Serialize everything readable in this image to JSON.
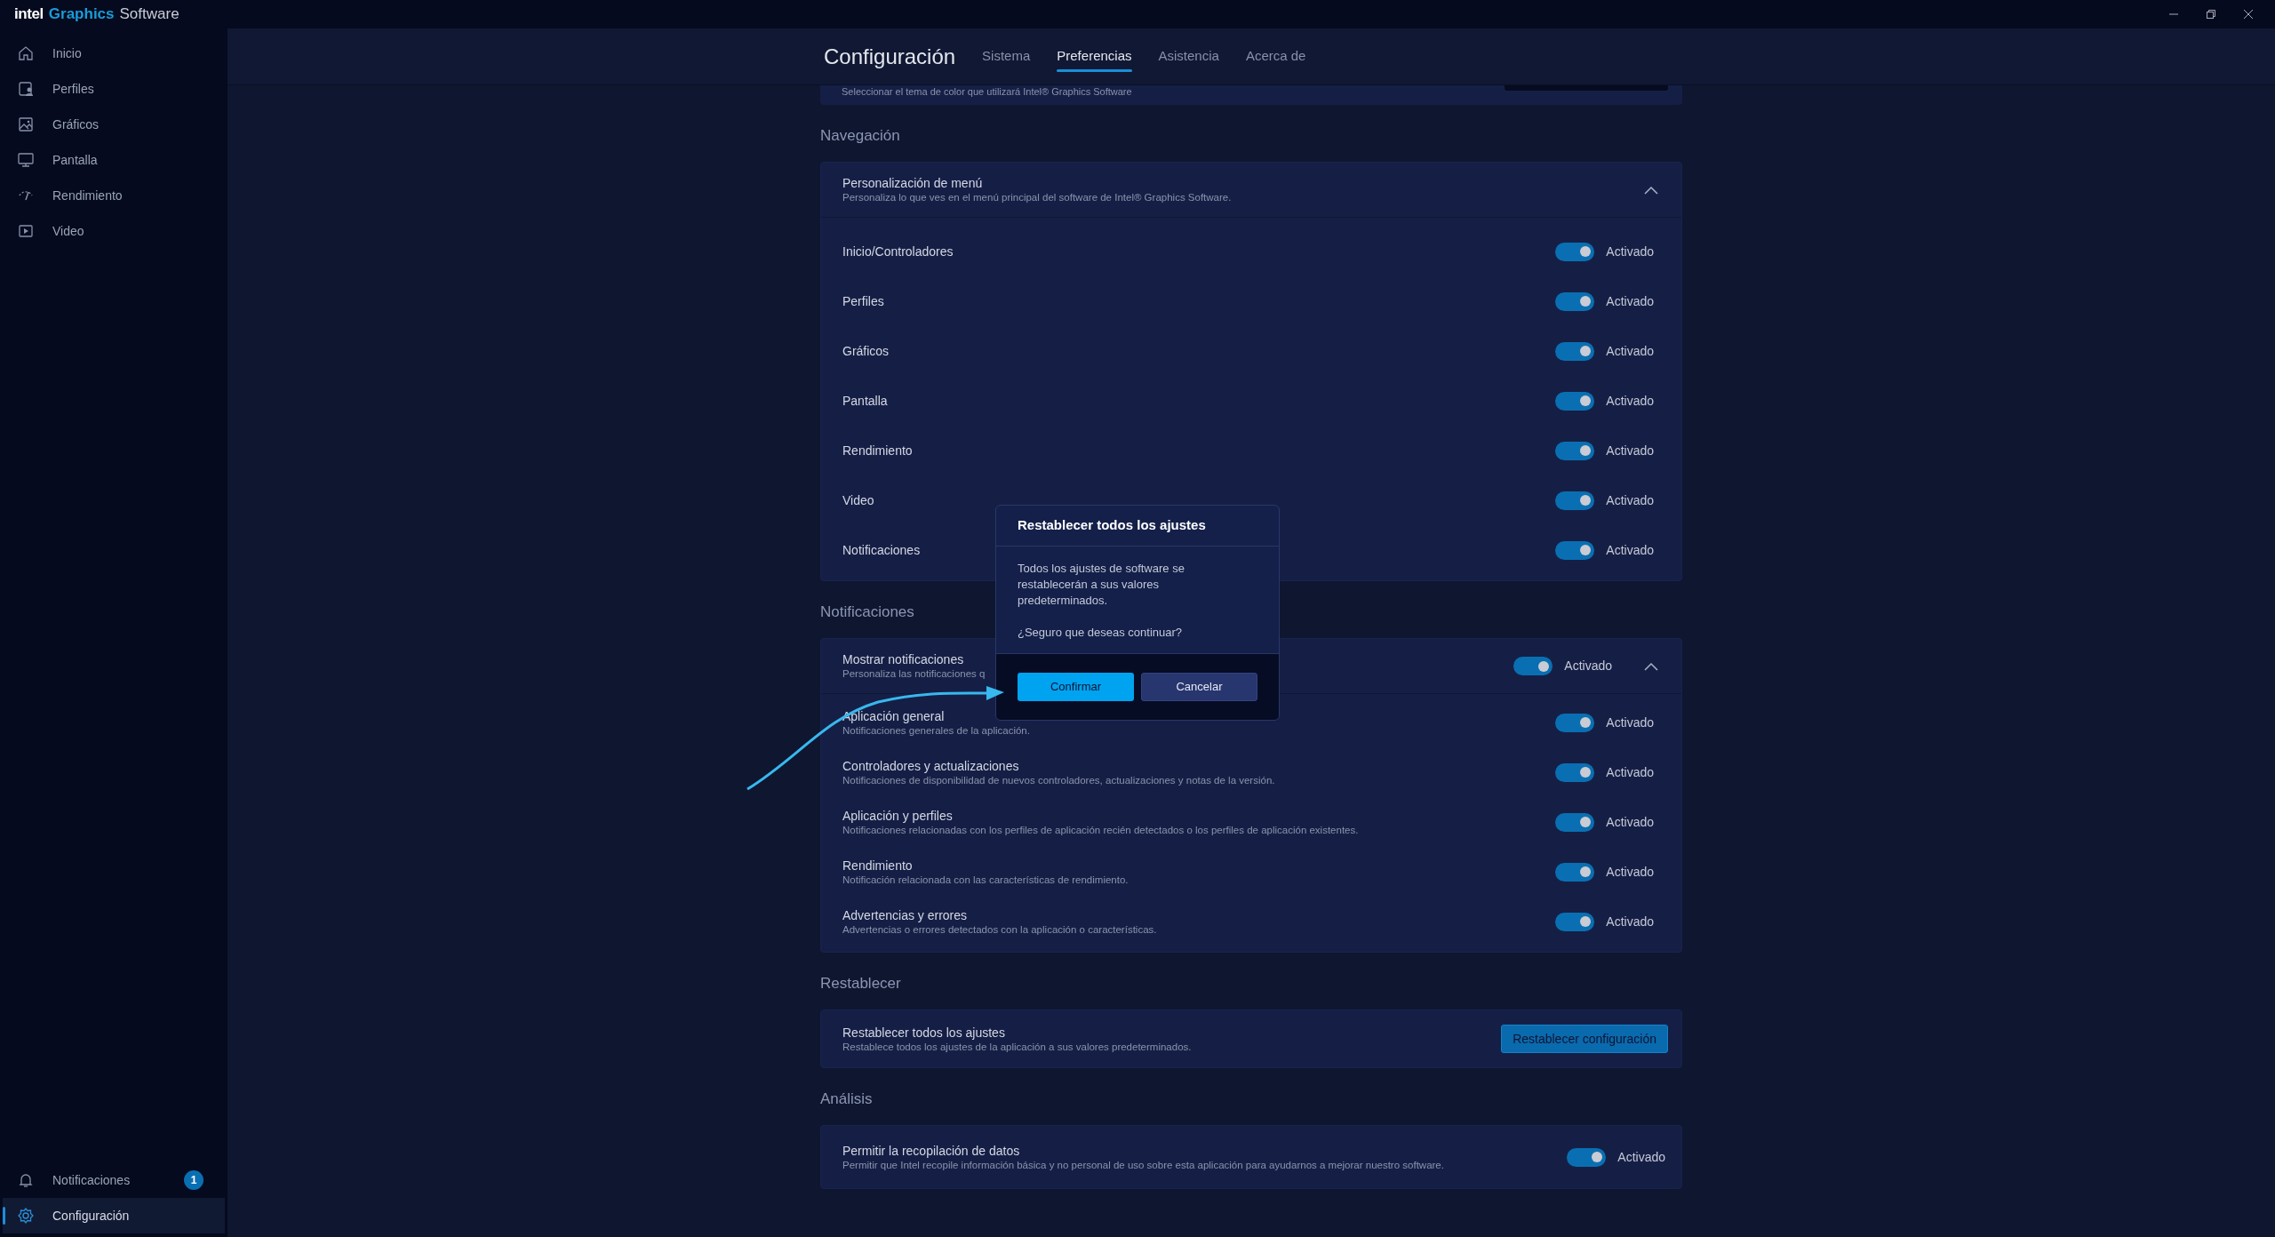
{
  "brand": {
    "intel": "intel",
    "graphics": "Graphics",
    "software": "Software"
  },
  "sidebar": {
    "items": [
      {
        "label": "Inicio",
        "kind": "home",
        "selected": false
      },
      {
        "label": "Perfiles",
        "kind": "profile",
        "selected": false
      },
      {
        "label": "Gráficos",
        "kind": "image",
        "selected": false
      },
      {
        "label": "Pantalla",
        "kind": "monitor",
        "selected": false
      },
      {
        "label": "Rendimiento",
        "kind": "gauge",
        "selected": false
      },
      {
        "label": "Video",
        "kind": "play",
        "selected": false
      }
    ],
    "bottom_items": [
      {
        "label": "Notificaciones",
        "kind": "bell",
        "badge": "1",
        "selected": false
      },
      {
        "label": "Configuración",
        "kind": "gear",
        "selected": true
      }
    ]
  },
  "header": {
    "title": "Configuración",
    "tabs": [
      {
        "label": "Sistema",
        "selected": false
      },
      {
        "label": "Preferencias",
        "selected": true
      },
      {
        "label": "Asistencia",
        "selected": false
      },
      {
        "label": "Acerca de",
        "selected": false
      }
    ]
  },
  "theme_card": {
    "description": "Seleccionar el tema de color que utilizará Intel® Graphics Software"
  },
  "sections": [
    {
      "heading": "Navegación",
      "kind": "group",
      "group": {
        "title": "Personalización de menú",
        "description": "Personaliza lo que ves en el menú principal del software de Intel® Graphics Software.",
        "expanded": true,
        "items": [
          {
            "label": "Inicio/Controladores",
            "on": true,
            "state": "Activado"
          },
          {
            "label": "Perfiles",
            "on": true,
            "state": "Activado"
          },
          {
            "label": "Gráficos",
            "on": true,
            "state": "Activado"
          },
          {
            "label": "Pantalla",
            "on": true,
            "state": "Activado"
          },
          {
            "label": "Rendimiento",
            "on": true,
            "state": "Activado"
          },
          {
            "label": "Video",
            "on": true,
            "state": "Activado"
          },
          {
            "label": "Notificaciones",
            "on": true,
            "state": "Activado"
          }
        ]
      }
    },
    {
      "heading": "Notificaciones",
      "kind": "group",
      "group": {
        "title": "Mostrar notificaciones",
        "description": "Personaliza las notificaciones q",
        "toggle": {
          "on": true,
          "state": "Activado"
        },
        "expanded": true,
        "items": [
          {
            "label": "Aplicación general",
            "description": "Notificaciones generales de la aplicación.",
            "on": true,
            "state": "Activado"
          },
          {
            "label": "Controladores y actualizaciones",
            "description": "Notificaciones de disponibilidad de nuevos controladores, actualizaciones y notas de la versión.",
            "on": true,
            "state": "Activado"
          },
          {
            "label": "Aplicación y perfiles",
            "description": "Notificaciones relacionadas con los perfiles de aplicación recién detectados o los perfiles de aplicación existentes.",
            "on": true,
            "state": "Activado"
          },
          {
            "label": "Rendimiento",
            "description": "Notificación relacionada con las características de rendimiento.",
            "on": true,
            "state": "Activado"
          },
          {
            "label": "Advertencias y errores",
            "description": "Advertencias o errores detectados con la aplicación o características.",
            "on": true,
            "state": "Activado"
          }
        ]
      }
    },
    {
      "heading": "Restablecer",
      "kind": "action",
      "title": "Restablecer todos los ajustes",
      "description": "Restablece todos los ajustes de la aplicación a sus valores predeterminados.",
      "button": "Restablecer configuración"
    },
    {
      "heading": "Análisis",
      "kind": "toggle",
      "title": "Permitir la recopilación de datos",
      "description": "Permitir que Intel recopile información básica y no personal de uso sobre esta aplicación para ayudarnos a mejorar nuestro software.",
      "on": true,
      "state": "Activado"
    }
  ],
  "dialog": {
    "title": "Restablecer todos los ajustes",
    "message": "Todos los ajustes de software se restablecerán a sus valores predeterminados.",
    "question": "¿Seguro que deseas continuar?",
    "buttons": [
      {
        "label": "Confirmar",
        "kind": "primary"
      },
      {
        "label": "Cancelar",
        "kind": "secondary"
      }
    ]
  }
}
